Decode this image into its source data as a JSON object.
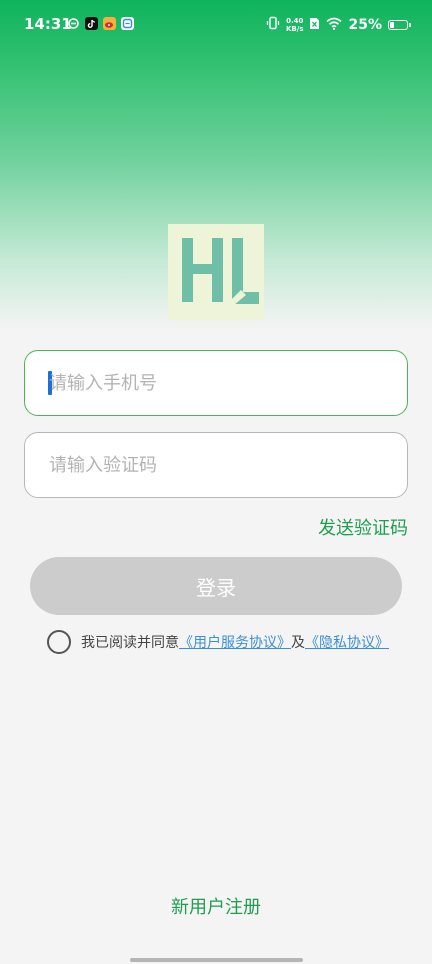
{
  "status_bar": {
    "time": "14:31",
    "netspeed_value": "0.40",
    "netspeed_unit": "KB/s",
    "battery_percent": "25%",
    "battery_level": 0.25,
    "app_icons": [
      "sync-icon",
      "tiktok-icon",
      "weibo-icon",
      "app-icon"
    ]
  },
  "logo": {
    "text": "HL",
    "color": "#6fbfa8",
    "background": "#eef4d8"
  },
  "form": {
    "phone_placeholder": "请输入手机号",
    "phone_value": "",
    "code_placeholder": "请输入验证码",
    "code_value": "",
    "send_code_label": "发送验证码",
    "login_label": "登录"
  },
  "agreement": {
    "prefix": "我已阅读并同意",
    "service_link": "《用户服务协议》",
    "joiner": "及",
    "privacy_link": "《隐私协议》",
    "checked": false
  },
  "footer": {
    "register_label": "新用户注册"
  },
  "colors": {
    "primary_green": "#1f9e4f",
    "focus_border": "#49b653",
    "link_blue": "#3b8fd9",
    "disabled_button": "#cccccc"
  }
}
